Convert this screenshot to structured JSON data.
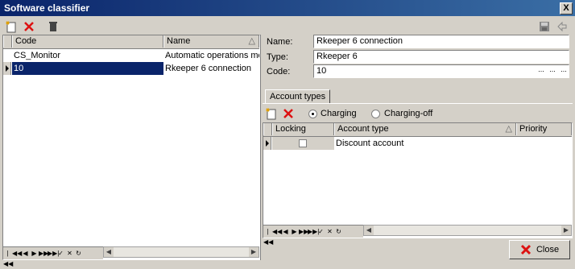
{
  "window": {
    "title": "Software classifier",
    "close_glyph": "X"
  },
  "toolbar": {
    "add_icon": "new-document-icon",
    "delete_icon": "red-x-icon",
    "trash_icon": "trash-icon",
    "save_icon": "floppy-disk-icon",
    "back_icon": "back-arrow-icon"
  },
  "left_grid": {
    "columns": [
      "Code",
      "Name"
    ],
    "sort_glyph": "△",
    "rows": [
      {
        "code": "CS_Monitor",
        "name": "Automatic operations monito"
      },
      {
        "code": "10",
        "name": "Rkeeper 6 connection"
      }
    ],
    "selected_row": 1
  },
  "form": {
    "name_label": "Name:",
    "name_value": "Rkeeper 6 connection",
    "type_label": "Type:",
    "type_value": "Rkeeper 6",
    "code_label": "Code:",
    "code_value": "10",
    "ellipsis": "..."
  },
  "tabs": {
    "account_types": "Account types"
  },
  "account_types": {
    "charging_label": "Charging",
    "chargingoff_label": "Charging-off",
    "selected_mode": "Charging",
    "columns": [
      "Locking",
      "Account type",
      "Priority"
    ],
    "sort_glyph": "△",
    "rows": [
      {
        "locking": false,
        "account_type": "Discount account",
        "priority": ""
      }
    ]
  },
  "navigator": {
    "buttons": [
      "|◀◀",
      "◀◀",
      "◀",
      "▶",
      "▶▶",
      "▶▶|",
      "✓",
      "✕",
      "↻"
    ]
  },
  "footer": {
    "close_label": "Close"
  },
  "colors": {
    "titlebar": "#0a246a",
    "selection": "#0a246a",
    "delete_red": "#d11",
    "face": "#d4d0c8"
  }
}
